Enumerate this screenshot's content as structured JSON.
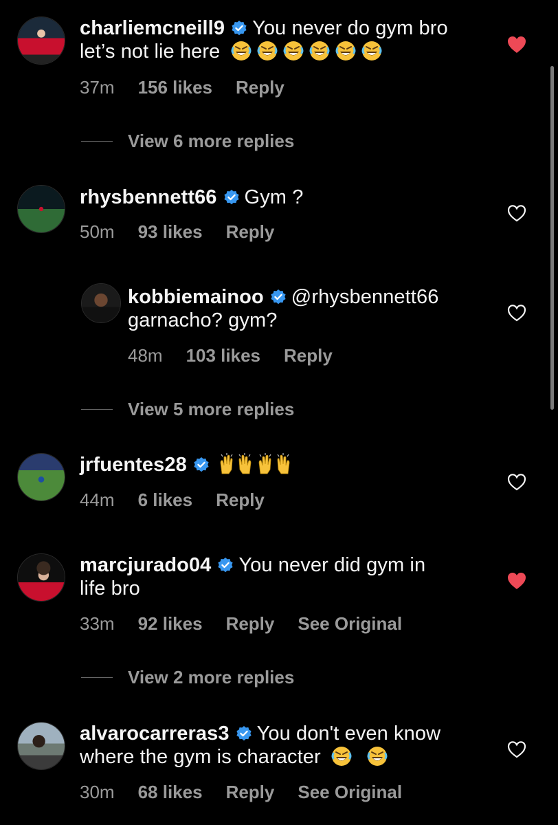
{
  "comments": [
    {
      "username": "charliemcneill9",
      "text_line1": "You never do gym bro",
      "text_line2": "let’s not lie here",
      "emojis": "rofl x6",
      "time": "37m",
      "likes": "156 likes",
      "reply": "Reply",
      "liked": true
    },
    {
      "username": "rhysbennett66",
      "text_line1": "Gym ?",
      "time": "50m",
      "likes": "93 likes",
      "reply": "Reply",
      "liked": false
    },
    {
      "username": "kobbiemainoo",
      "mention": "@rhysbennett66",
      "text_line2": "garnacho? gym?",
      "time": "48m",
      "likes": "103 likes",
      "reply": "Reply",
      "liked": false
    },
    {
      "username": "jrfuentes28",
      "emojis": "raising-hands x2",
      "time": "44m",
      "likes": "6 likes",
      "reply": "Reply",
      "liked": false
    },
    {
      "username": "marcjurado04",
      "text_line1": "You never did gym in",
      "text_line2": "life bro",
      "time": "33m",
      "likes": "92 likes",
      "reply": "Reply",
      "see_original": "See Original",
      "liked": true
    },
    {
      "username": "alvarocarreras3",
      "text_line1": "You don't even know",
      "text_line2": "where the gym is character",
      "emojis": "rofl x2",
      "time": "30m",
      "likes": "68 likes",
      "reply": "Reply",
      "see_original": "See Original",
      "liked": false
    }
  ],
  "more_replies": [
    "View 6 more replies",
    "View 5 more replies",
    "View 2 more replies"
  ],
  "colors": {
    "background": "#000000",
    "verified": "#3897f0",
    "liked_heart": "#ed4956",
    "secondary_text": "#9a9a9a"
  }
}
